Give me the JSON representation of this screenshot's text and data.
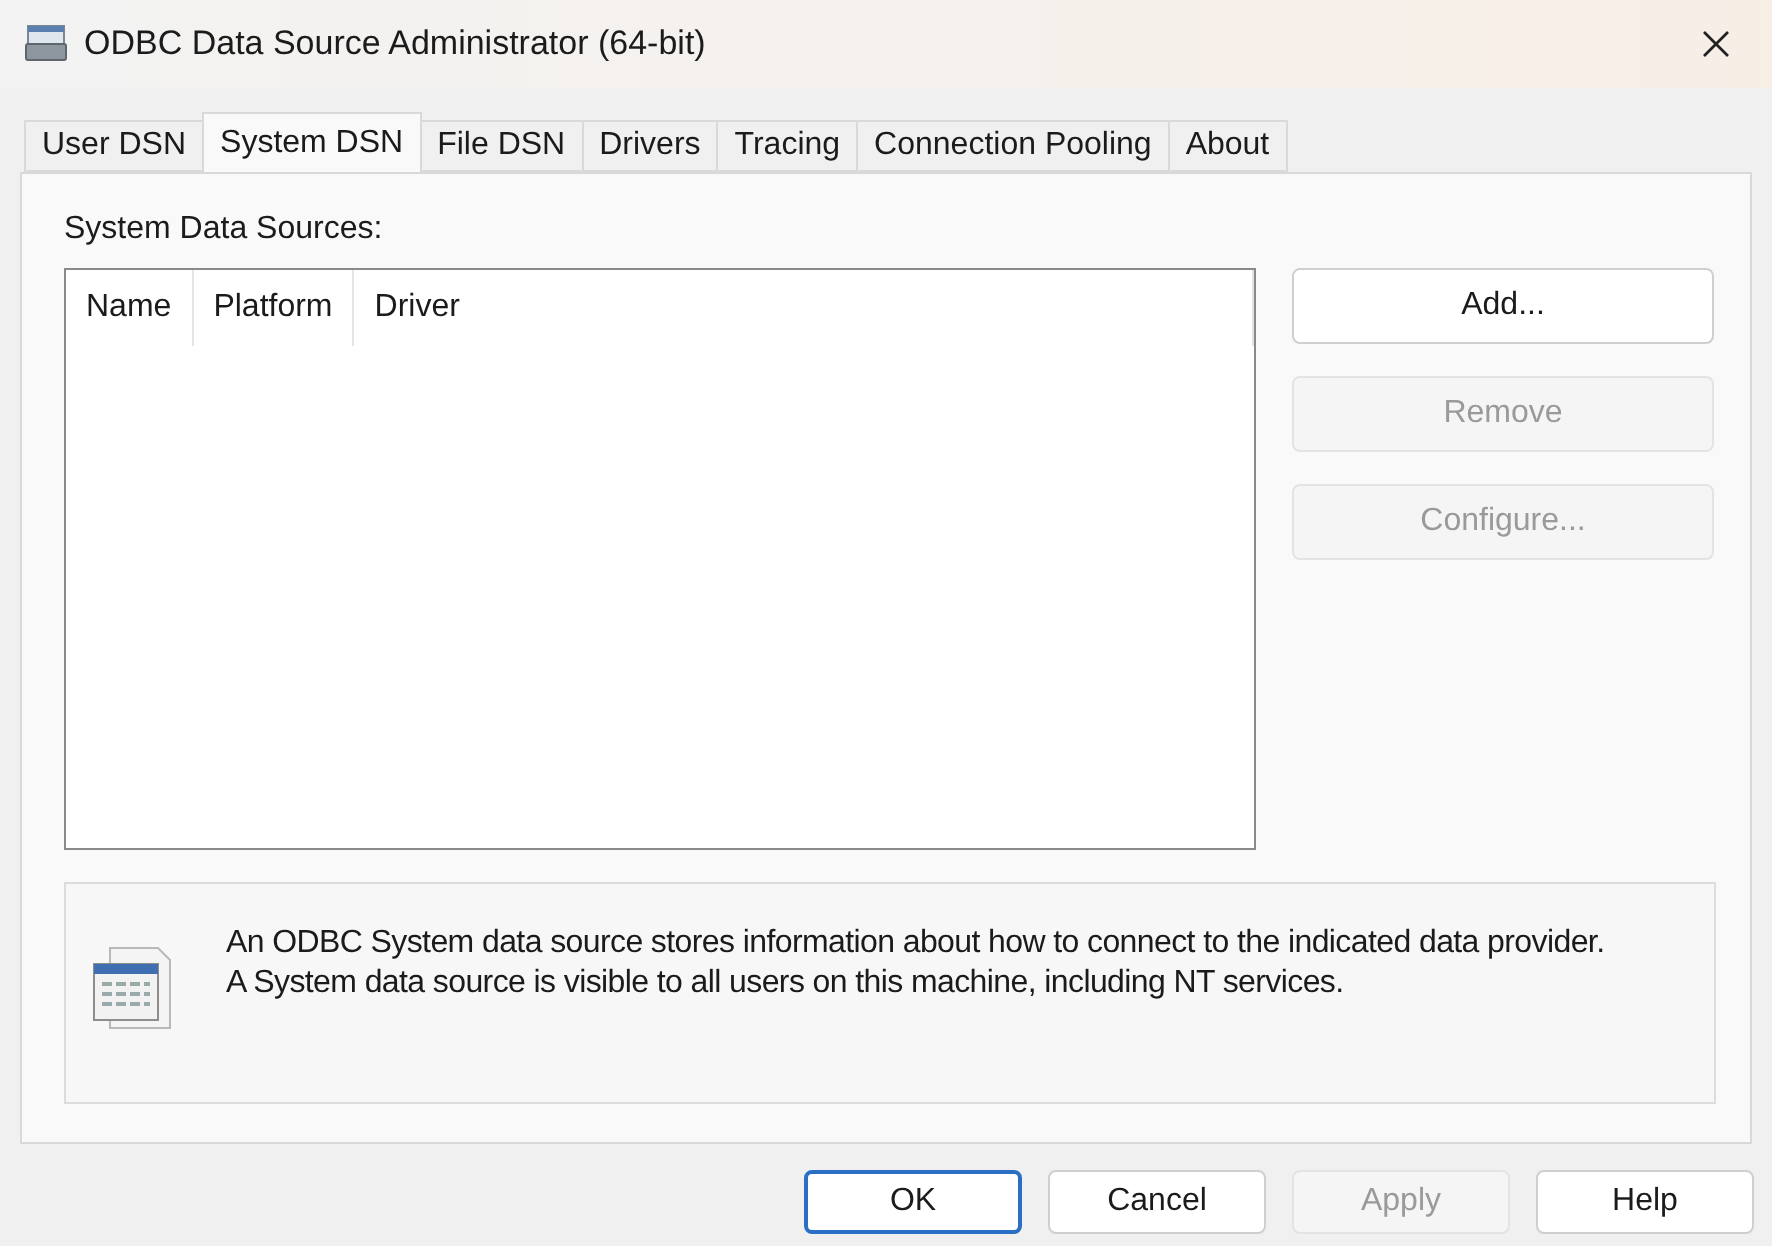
{
  "window": {
    "title": "ODBC Data Source Administrator (64-bit)"
  },
  "tabs": [
    {
      "label": "User DSN",
      "selected": false
    },
    {
      "label": "System DSN",
      "selected": true
    },
    {
      "label": "File DSN",
      "selected": false
    },
    {
      "label": "Drivers",
      "selected": false
    },
    {
      "label": "Tracing",
      "selected": false
    },
    {
      "label": "Connection Pooling",
      "selected": false
    },
    {
      "label": "About",
      "selected": false
    }
  ],
  "list": {
    "label": "System Data Sources:",
    "columns": [
      "Name",
      "Platform",
      "Driver"
    ]
  },
  "side_buttons": [
    {
      "label": "Add...",
      "disabled": false
    },
    {
      "label": "Remove",
      "disabled": true
    },
    {
      "label": "Configure...",
      "disabled": true
    }
  ],
  "info": {
    "lines": [
      "An ODBC System data source stores information about how to connect to the indicated data provider.",
      "A System data source is visible to all users on this machine, including NT services."
    ]
  },
  "buttons": [
    {
      "label": "OK",
      "disabled": false,
      "default": true
    },
    {
      "label": "Cancel",
      "disabled": false,
      "default": false
    },
    {
      "label": "Apply",
      "disabled": true,
      "default": false
    },
    {
      "label": "Help",
      "disabled": false,
      "default": false
    }
  ]
}
